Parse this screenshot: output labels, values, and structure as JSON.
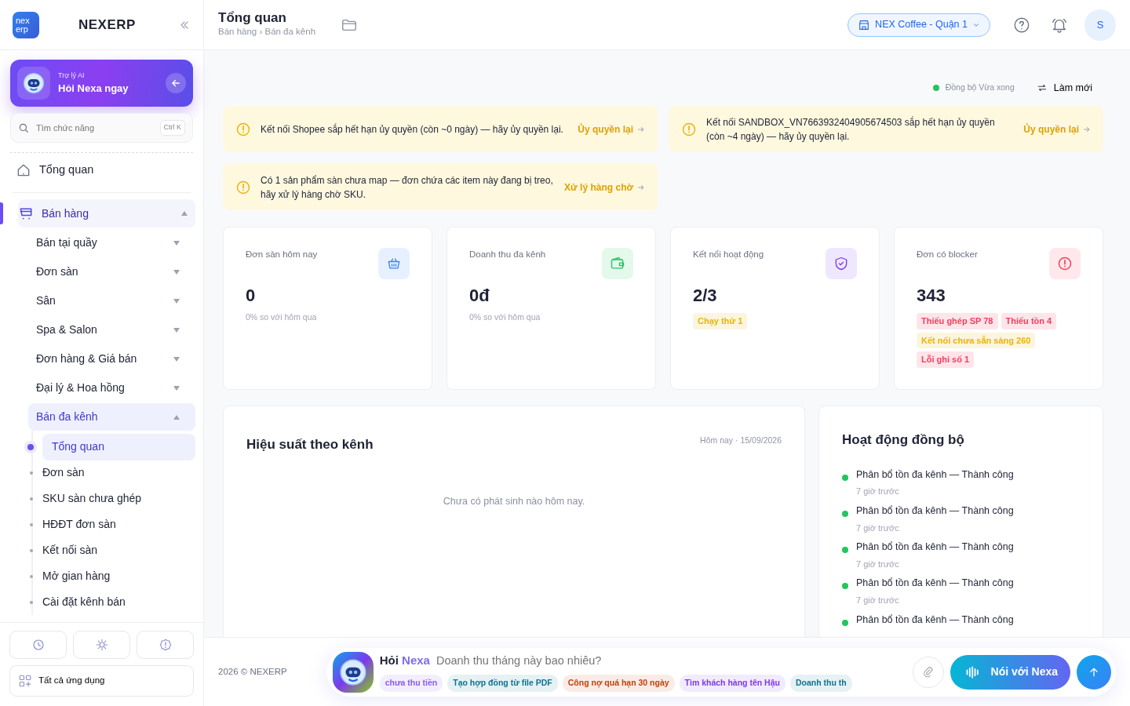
{
  "brand": {
    "logo_top": "nex",
    "logo_bottom": "erp",
    "name": "NEXERP"
  },
  "ai_card": {
    "label": "Trợ lý AI",
    "title": "Hỏi Nexa ngay"
  },
  "search": {
    "placeholder": "Tìm chức năng",
    "shortcut": "Ctrl K"
  },
  "nav": [
    {
      "label": "Tổng quan",
      "selected": false
    },
    {
      "label": "Bán hàng",
      "selected": true,
      "expanded": true,
      "children": [
        {
          "label": "Bán tại quầy",
          "expanded": false,
          "selected": false
        },
        {
          "label": "Đơn sàn",
          "expanded": false,
          "selected": false
        },
        {
          "label": "Sân",
          "expanded": false,
          "selected": false
        },
        {
          "label": "Spa & Salon",
          "expanded": false,
          "selected": false
        },
        {
          "label": "Đơn hàng & Giá bán",
          "expanded": false,
          "selected": false
        },
        {
          "label": "Đại lý & Hoa hồng",
          "expanded": false,
          "selected": false
        },
        {
          "label": "Bán đa kênh",
          "expanded": true,
          "selected": true,
          "children": [
            {
              "label": "Tổng quan",
              "selected": true
            },
            {
              "label": "Đơn sàn",
              "selected": false
            },
            {
              "label": "SKU sàn chưa ghép",
              "selected": false
            },
            {
              "label": "HĐĐT đơn sàn",
              "selected": false
            },
            {
              "label": "Kết nối sàn",
              "selected": false
            },
            {
              "label": "Mở gian hàng",
              "selected": false
            },
            {
              "label": "Cài đặt kênh bán",
              "selected": false
            }
          ]
        }
      ]
    }
  ],
  "sidebar_footer": {
    "all_apps": "Tất cả ứng dụng"
  },
  "header": {
    "title": "Tổng quan",
    "breadcrumb": "Bán hàng › Bán đa kênh",
    "store": "NEX Coffee - Quận 1",
    "avatar": "S"
  },
  "sync": {
    "status": "Đồng bộ Vừa xong",
    "color": "#22c55e",
    "refresh": "Làm mới"
  },
  "alerts": [
    {
      "text": "Kết nối Shopee sắp hết hạn ủy quyền (còn ~0 ngày) — hãy ủy quyền lại.",
      "action": "Ủy quyền lại"
    },
    {
      "text": "Kết nối SANDBOX_VN7663932404905674503 sắp hết hạn ủy quyền (còn ~4 ngày) — hãy ủy quyền lại.",
      "action": "Ủy quyền lại"
    },
    {
      "text": "Có 1 sản phẩm sàn chưa map — đơn chứa các item này đang bị treo, hãy xử lý hàng chờ SKU.",
      "action": "Xử lý hàng chờ"
    }
  ],
  "stats": [
    {
      "label": "Đơn sàn hôm nay",
      "value": "0",
      "sub": "0% so với hôm qua",
      "color": "#3b82f6"
    },
    {
      "label": "Doanh thu đa kênh",
      "value": "0đ",
      "sub": "0% so với hôm qua",
      "color": "#22c55e"
    },
    {
      "label": "Kết nối hoạt động",
      "value": "2/3",
      "color": "#7c3aed",
      "tags": [
        {
          "text": "Chạy thử 1",
          "color": "#eab308"
        }
      ]
    },
    {
      "label": "Đơn có blocker",
      "value": "343",
      "color": "#f43f5e",
      "tags": [
        {
          "text": "Thiếu ghép SP 78",
          "color": "#f43f5e"
        },
        {
          "text": "Thiếu tồn 4",
          "color": "#f43f5e"
        },
        {
          "text": "Kết nối chưa sẵn sàng 260",
          "color": "#eab308"
        },
        {
          "text": "Lỗi ghi số 1",
          "color": "#f43f5e"
        }
      ]
    }
  ],
  "performance": {
    "title": "Hiệu suất theo kênh",
    "date": "Hôm nay · 15/09/2026",
    "empty": "Chưa có phát sinh nào hôm nay."
  },
  "activity": {
    "title": "Hoạt động đồng bộ",
    "items": [
      {
        "text": "Phân bổ tồn đa kênh — Thành công",
        "time": "7 giờ trước",
        "color": "#22c55e"
      },
      {
        "text": "Phân bổ tồn đa kênh — Thành công",
        "time": "7 giờ trước",
        "color": "#22c55e"
      },
      {
        "text": "Phân bổ tồn đa kênh — Thành công",
        "time": "7 giờ trước",
        "color": "#22c55e"
      },
      {
        "text": "Phân bổ tồn đa kênh — Thành công",
        "time": "7 giờ trước",
        "color": "#22c55e"
      },
      {
        "text": "Phân bổ tồn đa kênh — Thành công",
        "color": "#22c55e"
      }
    ]
  },
  "footer": {
    "copyright": "2026 © NEXERP"
  },
  "ask_bar": {
    "ask": "Hỏi",
    "name": "Nexa",
    "placeholder": "Doanh thu tháng này bao nhiêu?",
    "voice": "Nói với Nexa",
    "chips": [
      {
        "text": "chưa thu tiền",
        "color": "#8b5cf6"
      },
      {
        "text": "Tạo hợp đồng từ file PDF",
        "color": "#0e7490"
      },
      {
        "text": "Công nợ quá hạn 30 ngày",
        "color": "#c2410c"
      },
      {
        "text": "Tìm khách hàng tên Hậu",
        "color": "#7c3aed"
      },
      {
        "text": "Doanh thu th",
        "color": "#0e7490"
      }
    ]
  }
}
